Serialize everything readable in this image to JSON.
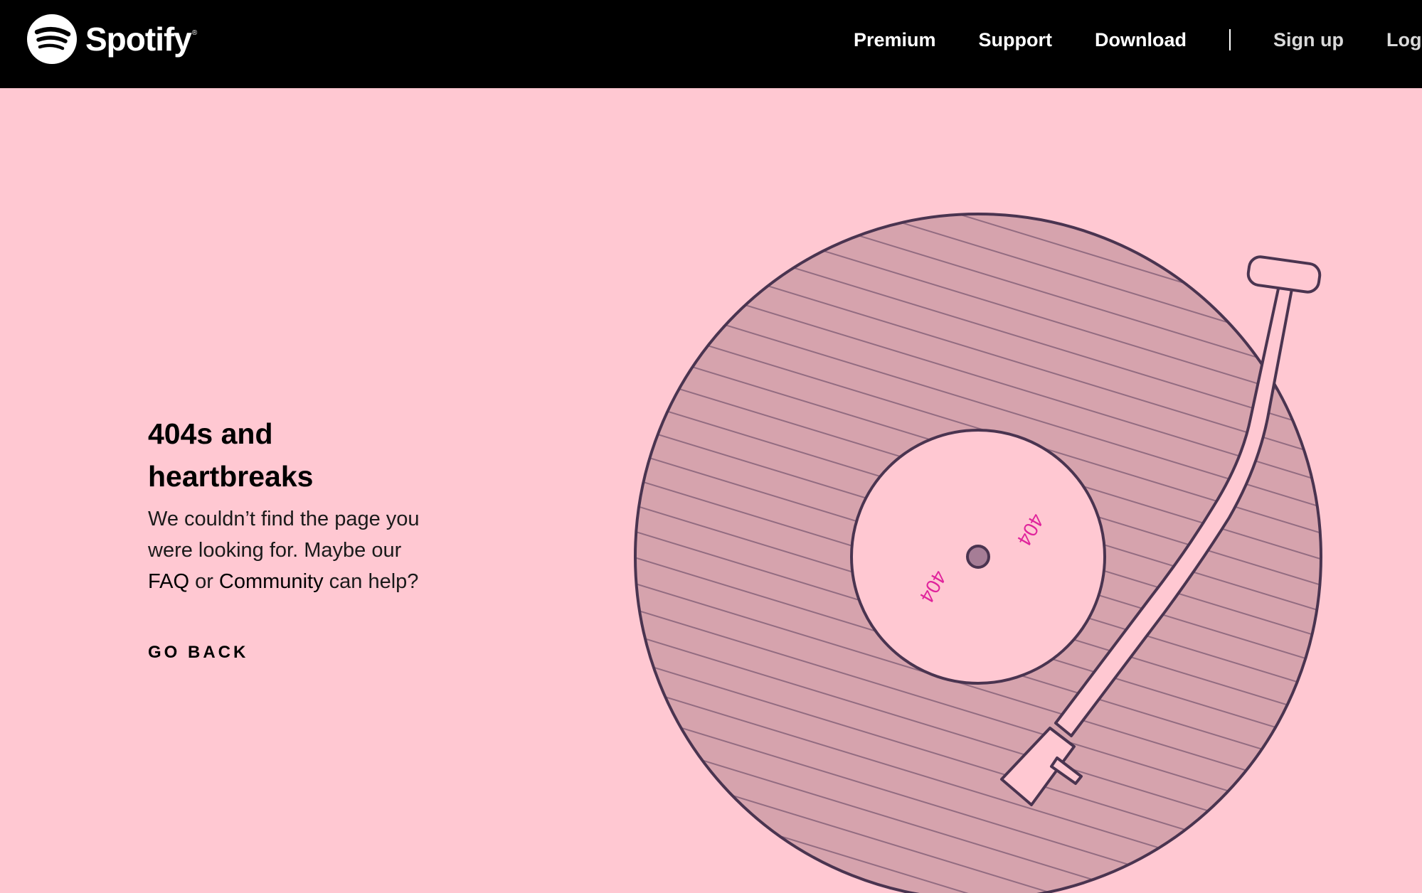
{
  "header": {
    "brand": "Spotify",
    "brand_mark": "®",
    "logo_icon": "spotify-logo-icon",
    "nav": {
      "premium": "Premium",
      "support": "Support",
      "download": "Download",
      "signup": "Sign up",
      "login": "Log"
    }
  },
  "main": {
    "title": "404s and heartbreaks",
    "message_before": "We couldn’t find the page you were looking for. Maybe our ",
    "faq_link": "FAQ",
    "message_or": " or ",
    "community_link": "Community",
    "message_after": " can help?",
    "go_back": "GO BACK"
  },
  "record": {
    "label_text_1": "404",
    "label_text_2": "404"
  },
  "colors": {
    "background": "#ffc8d2",
    "header": "#000000",
    "record_fill": "#d6a3ad",
    "outline": "#4a3450",
    "label_text": "#e0249c"
  }
}
